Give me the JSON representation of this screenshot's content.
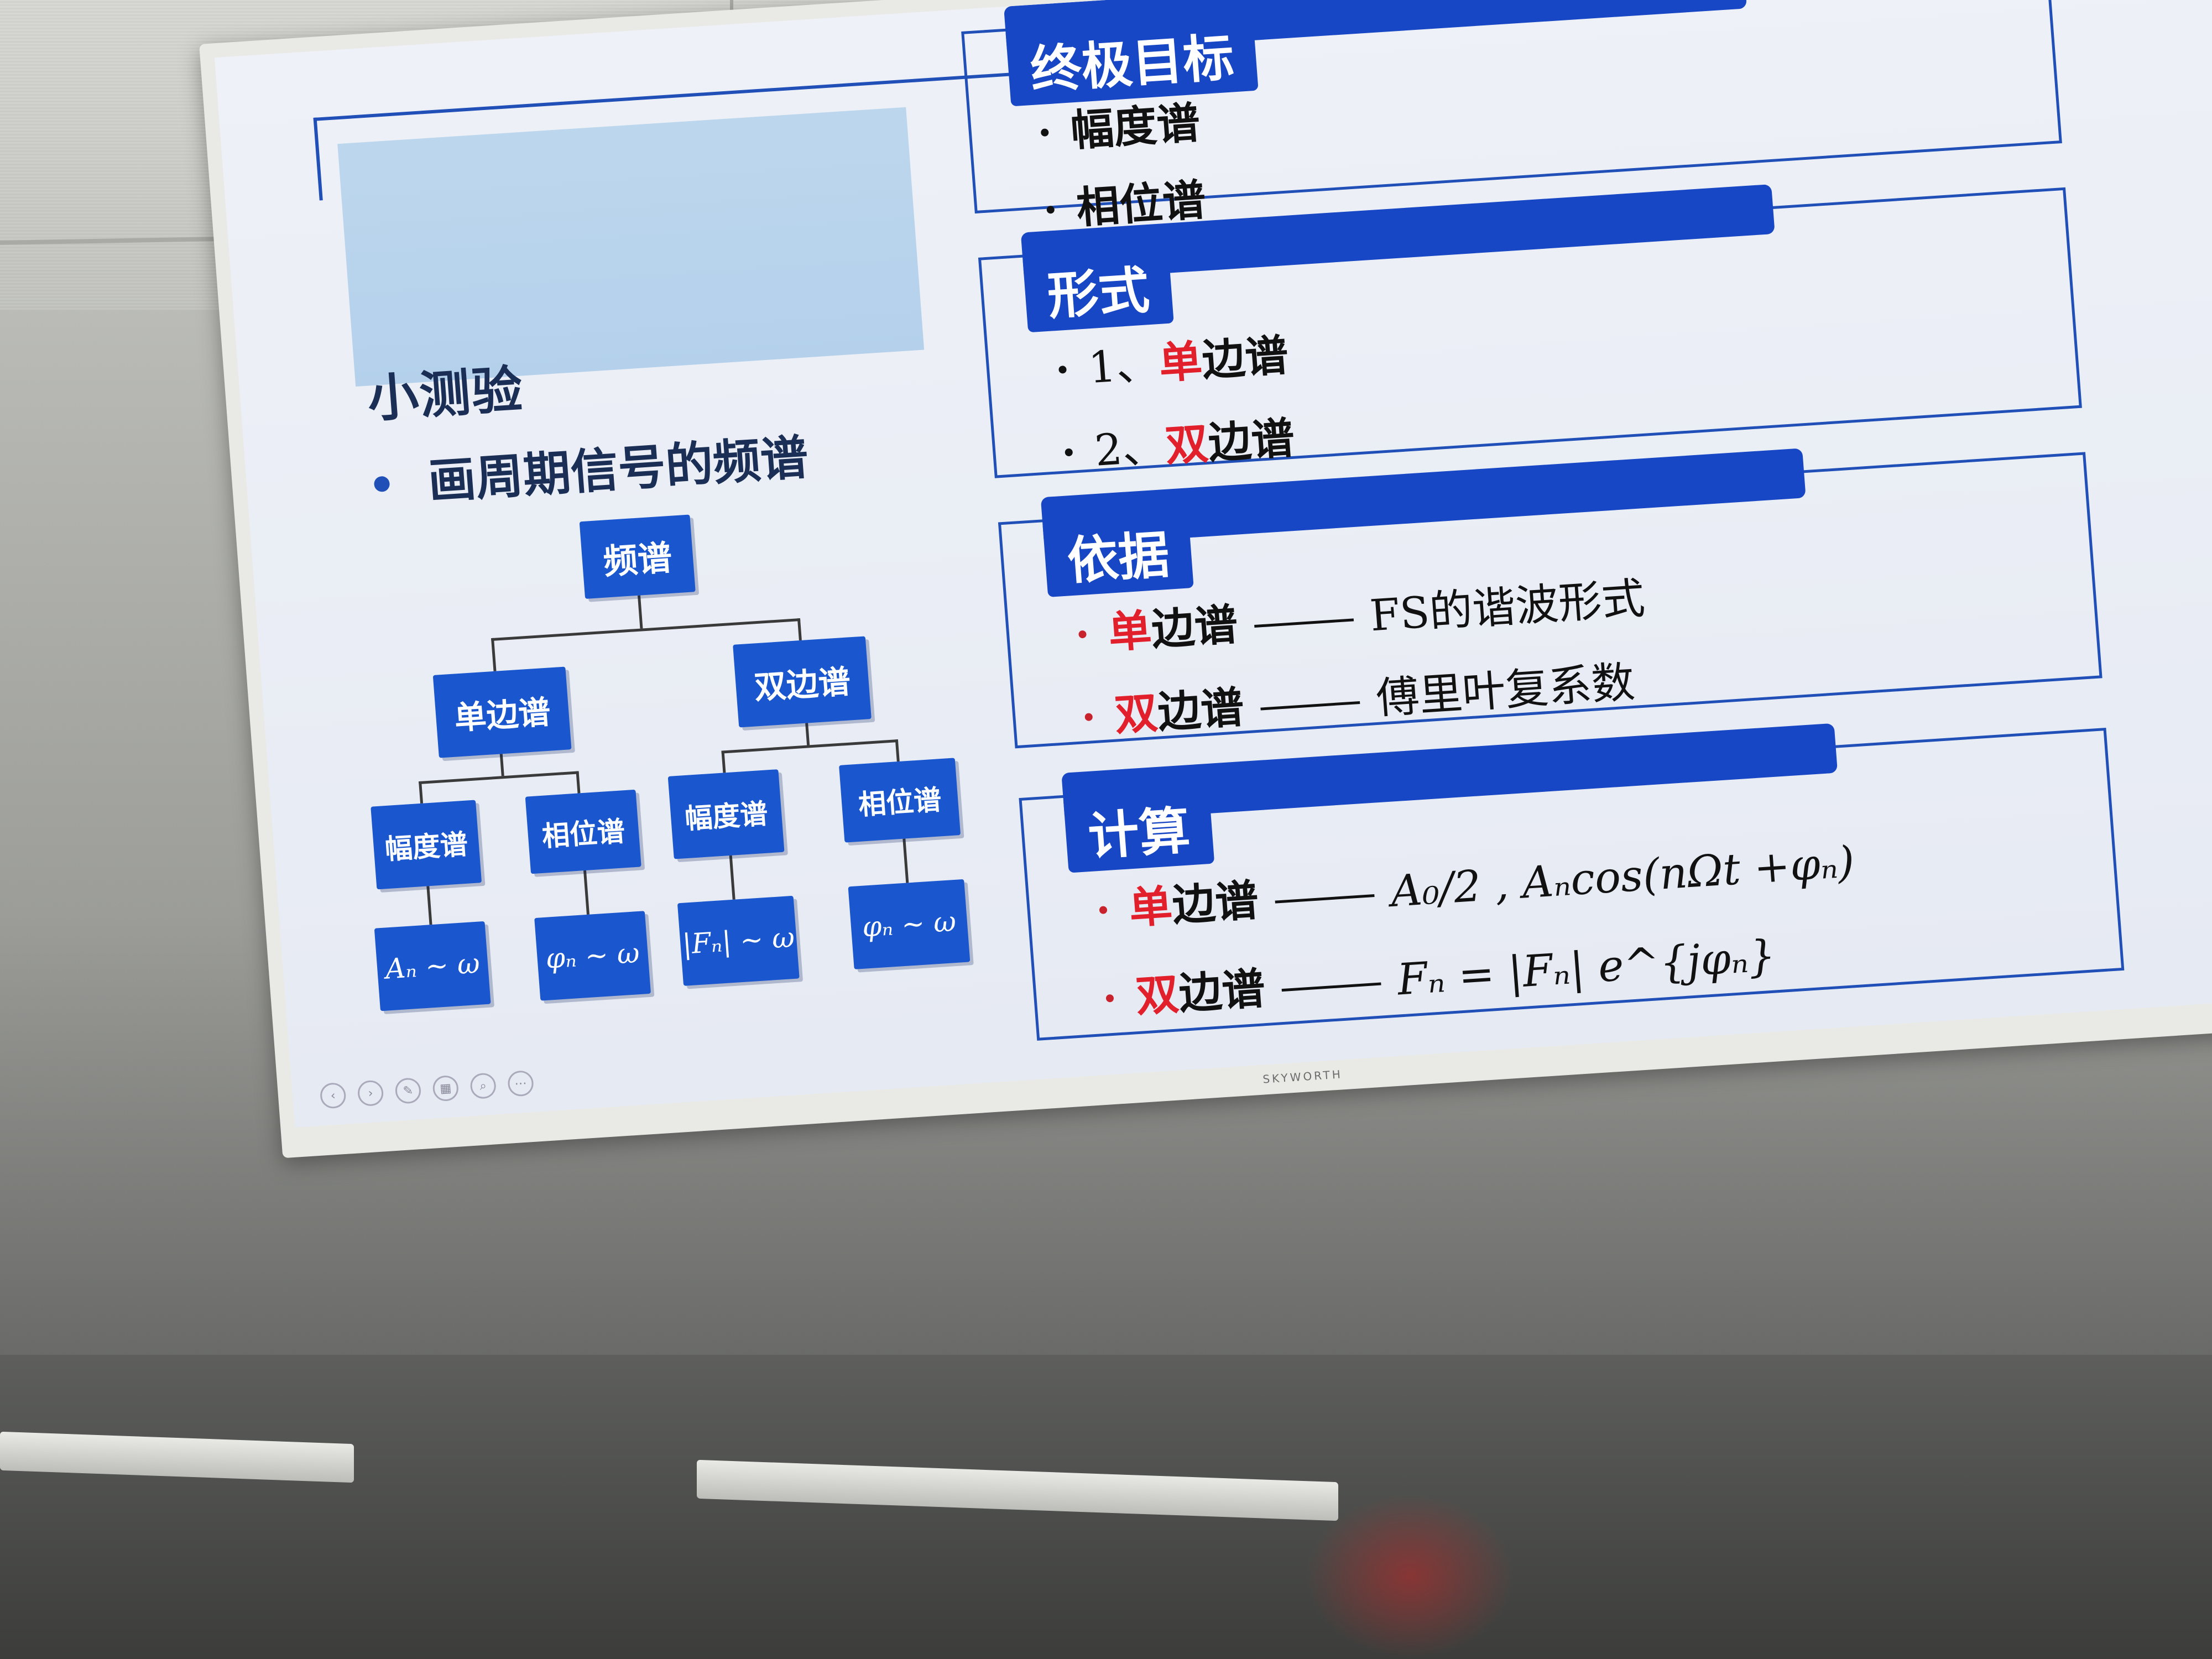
{
  "tv": {
    "brand": "SKYWORTH"
  },
  "slide": {
    "left": {
      "title": "小测验",
      "bullet": "画周期信号的频谱"
    },
    "tree": {
      "root": "频谱",
      "branches": [
        {
          "label": "单边谱",
          "children": [
            {
              "label": "幅度谱",
              "formula": "Aₙ ~ ω"
            },
            {
              "label": "相位谱",
              "formula": "φₙ ~ ω"
            }
          ]
        },
        {
          "label": "双边谱",
          "children": [
            {
              "label": "幅度谱",
              "formula": "|Fₙ| ~ ω"
            },
            {
              "label": "相位谱",
              "formula": "φₙ ~ ω"
            }
          ]
        }
      ]
    },
    "panels": [
      {
        "title": "终极目标",
        "items": [
          {
            "text": "幅度谱"
          },
          {
            "text": "相位谱"
          }
        ]
      },
      {
        "title": "形式",
        "items": [
          {
            "prefix": "1、",
            "highlight": "单",
            "text": "边谱"
          },
          {
            "prefix": "2、",
            "highlight": "双",
            "text": "边谱"
          }
        ]
      },
      {
        "title": "依据",
        "items": [
          {
            "highlight": "单",
            "text": "边谱",
            "detail": "FS的谐波形式"
          },
          {
            "highlight": "双",
            "text": "边谱",
            "detail": "傅里叶复系数"
          }
        ]
      },
      {
        "title": "计算",
        "items": [
          {
            "highlight": "单",
            "text": "边谱",
            "detail": "A₀/2 , Aₙcos(nΩt +φₙ)"
          },
          {
            "highlight": "双",
            "text": "边谱",
            "detail": "Fₙ = |Fₙ| e^{jφₙ}"
          }
        ]
      }
    ]
  }
}
